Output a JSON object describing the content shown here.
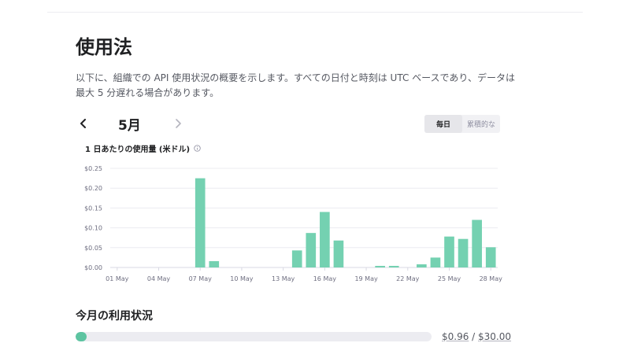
{
  "page": {
    "title": "使用法",
    "intro": "以下に、組織での API 使用状況の概要を示します。すべての日付と時刻は UTC ベースであり、データは最大 5 分遅れる場合があります。"
  },
  "month_nav": {
    "label": "5月",
    "prev_icon": "chevron-left-icon",
    "next_icon": "chevron-right-icon"
  },
  "view_toggle": {
    "daily": "毎日",
    "cumulative": "累積的な",
    "selected": "daily"
  },
  "chart_title": "1 日あたりの使用量 (米ドル)",
  "usage": {
    "title": "今月の利用状況",
    "spent": "$0.96",
    "separator": " / ",
    "limit": "$30.00",
    "fraction": 0.032
  },
  "colors": {
    "bar": "#74d1b1",
    "accent": "#5dc4a1"
  },
  "chart_data": {
    "type": "bar",
    "title": "1 日あたりの使用量 (米ドル)",
    "xlabel": "",
    "ylabel": "",
    "ylim": [
      0,
      0.25
    ],
    "yticks": [
      0,
      0.05,
      0.1,
      0.15,
      0.2,
      0.25
    ],
    "ytick_labels": [
      "$0.00",
      "$0.05",
      "$0.10",
      "$0.15",
      "$0.20",
      "$0.25"
    ],
    "xtick_labels": [
      "01 May",
      "04 May",
      "07 May",
      "10 May",
      "13 May",
      "16 May",
      "19 May",
      "22 May",
      "25 May",
      "28 May"
    ],
    "grid": true,
    "categories": [
      "01 May",
      "02 May",
      "03 May",
      "04 May",
      "05 May",
      "06 May",
      "07 May",
      "08 May",
      "09 May",
      "10 May",
      "11 May",
      "12 May",
      "13 May",
      "14 May",
      "15 May",
      "16 May",
      "17 May",
      "18 May",
      "19 May",
      "20 May",
      "21 May",
      "22 May",
      "23 May",
      "24 May",
      "25 May",
      "26 May",
      "27 May",
      "28 May"
    ],
    "values": [
      0,
      0,
      0,
      0,
      0,
      0,
      0.225,
      0.016,
      0,
      0,
      0,
      0,
      0,
      0.043,
      0.087,
      0.14,
      0.068,
      0,
      0,
      0.004,
      0.004,
      0,
      0.008,
      0.025,
      0.078,
      0.072,
      0.12,
      0.051
    ]
  }
}
